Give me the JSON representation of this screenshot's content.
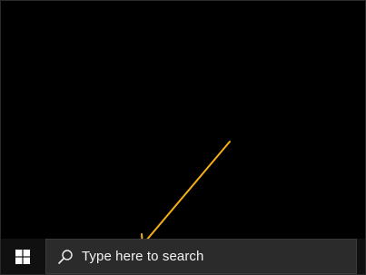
{
  "taskbar": {
    "start_icon": "windows-logo-icon",
    "search": {
      "icon": "search-icon",
      "placeholder": "Type here to search"
    }
  },
  "annotation": {
    "icon": "arrow-annotation",
    "color": "#f5b016"
  },
  "colors": {
    "desktop": "#000000",
    "taskbar": "#101010",
    "search_box": "#2b2b2b",
    "text": "#f2f2f2"
  }
}
